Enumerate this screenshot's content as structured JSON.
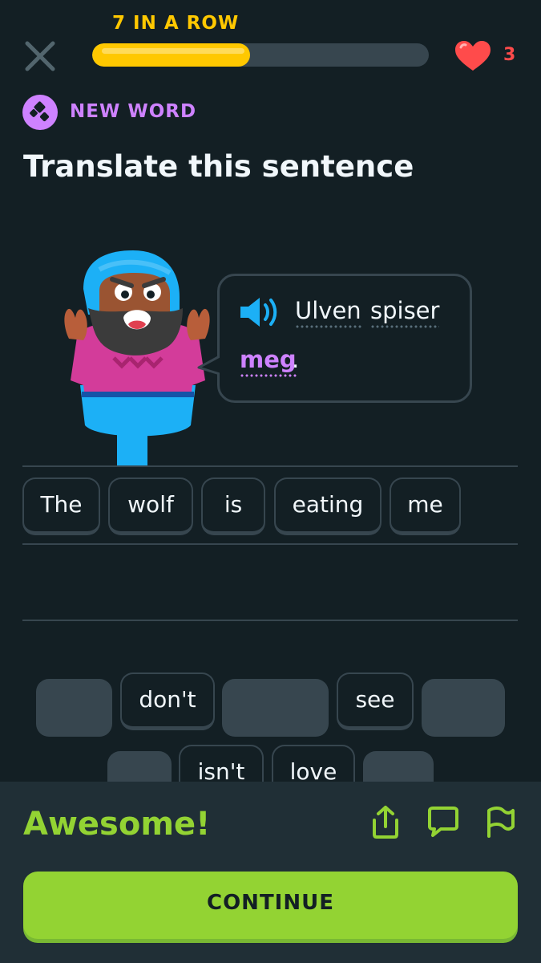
{
  "header": {
    "streak_label": "7 IN A ROW",
    "progress_fraction": 0.47,
    "hearts_count": "3"
  },
  "badge": {
    "label": "NEW WORD",
    "icon": "new-word-icon"
  },
  "prompt": {
    "title": "Translate this sentence"
  },
  "bubble": {
    "words": [
      "Ulven",
      "spiser",
      "meg",
      "."
    ],
    "highlight_word": "meg"
  },
  "answer": {
    "chips": [
      "The",
      "wolf",
      "is",
      "eating",
      "me"
    ]
  },
  "word_bank": {
    "row1": [
      {
        "label": "",
        "used": true
      },
      {
        "label": "don't",
        "used": false
      },
      {
        "label": "",
        "used": true
      },
      {
        "label": "see",
        "used": false
      },
      {
        "label": "",
        "used": true
      }
    ],
    "row2": [
      {
        "label": "",
        "used": true
      },
      {
        "label": "isn't",
        "used": false
      },
      {
        "label": "love",
        "used": false
      },
      {
        "label": "",
        "used": true
      }
    ]
  },
  "footer": {
    "message": "Awesome!",
    "continue_label": "CONTINUE",
    "icons": [
      "share-icon",
      "comment-icon",
      "flag-icon"
    ]
  },
  "colors": {
    "background": "#131f24",
    "streak": "#ffc800",
    "heart": "#ff4b4b",
    "new_word": "#ce82ff",
    "success": "#93d333",
    "footer_bg": "#202f36",
    "border": "#37464f"
  }
}
